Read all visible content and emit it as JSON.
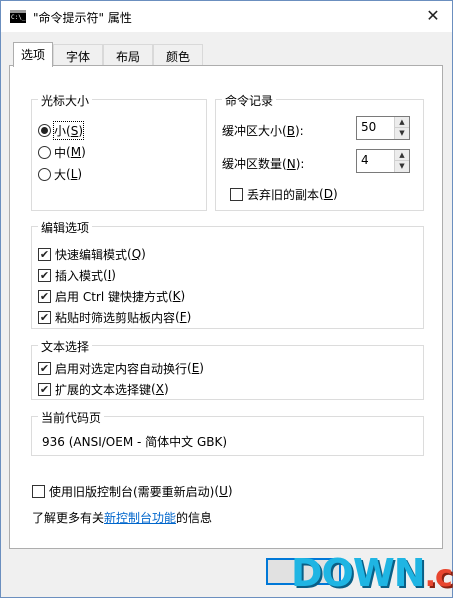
{
  "window": {
    "title": "\"命令提示符\" 属性",
    "icon_label": "C:\\_",
    "close_symbol": "✕"
  },
  "tabs": [
    {
      "label": "选项",
      "active": true
    },
    {
      "label": "字体",
      "active": false
    },
    {
      "label": "布局",
      "active": false
    },
    {
      "label": "颜色",
      "active": false
    }
  ],
  "cursor_size": {
    "title": "光标大小",
    "options": [
      {
        "label": "小",
        "key": "S",
        "selected": true
      },
      {
        "label": "中",
        "key": "M",
        "selected": false
      },
      {
        "label": "大",
        "key": "L",
        "selected": false
      }
    ]
  },
  "command_history": {
    "title": "命令记录",
    "buffer_size": {
      "label": "缓冲区大小",
      "key": "B",
      "value": "50"
    },
    "buffer_count": {
      "label": "缓冲区数量",
      "key": "N",
      "value": "4"
    },
    "discard_duplicates": {
      "label": "丢弃旧的副本",
      "key": "D",
      "checked": false
    }
  },
  "edit_options": {
    "title": "编辑选项",
    "items": [
      {
        "label": "快速编辑模式",
        "key": "Q",
        "checked": true
      },
      {
        "label": "插入模式",
        "key": "I",
        "checked": true
      },
      {
        "label": "启用 Ctrl 键快捷方式",
        "key": "K",
        "checked": true
      },
      {
        "label": "粘贴时筛选剪贴板内容",
        "key": "F",
        "checked": true
      }
    ]
  },
  "text_selection": {
    "title": "文本选择",
    "items": [
      {
        "label": "启用对选定内容自动换行",
        "key": "E",
        "checked": true
      },
      {
        "label": "扩展的文本选择键",
        "key": "X",
        "checked": true
      }
    ]
  },
  "code_page": {
    "title": "当前代码页",
    "value": "936   (ANSI/OEM - 简体中文 GBK)"
  },
  "legacy_console": {
    "label": "使用旧版控制台(需要重新启动)",
    "key": "U",
    "checked": false
  },
  "info": {
    "prefix": "了解更多有关",
    "link": "新控制台功能",
    "suffix": "的信息"
  },
  "check_mark": "✔",
  "spinner": {
    "up": "▲",
    "down": "▼"
  },
  "watermark": {
    "main": "DOWN",
    "suffix": ".cc"
  }
}
